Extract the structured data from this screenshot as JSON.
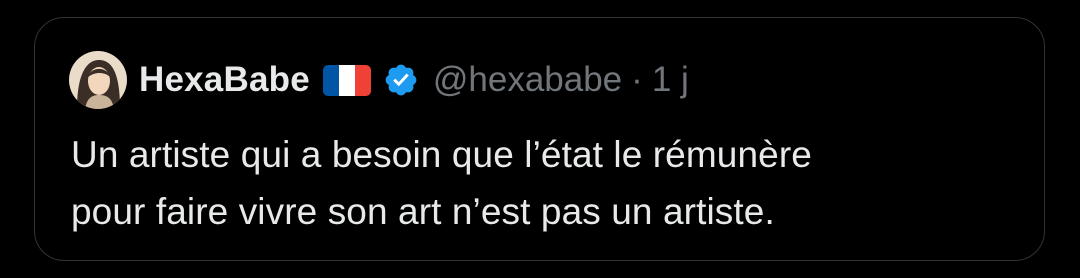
{
  "quote": {
    "author": {
      "display_name": "HexaBabe",
      "flag_icon": "france-flag-icon",
      "flag_colors": [
        "#0055A4",
        "#FFFFFF",
        "#EF4135"
      ],
      "verified_icon": "verified-badge-icon",
      "verified_color": "#1d9bf0",
      "handle": "@hexababe",
      "separator": "·",
      "time_ago": "1 j"
    },
    "text_line_1": "Un artiste qui a besoin que l’état le rémunère",
    "text_line_2": "pour faire vivre son art n’est pas un artiste."
  },
  "colors": {
    "background": "#000000",
    "border": "#2f3336",
    "primary_text": "#e7e9ea",
    "secondary_text": "#71767b"
  }
}
